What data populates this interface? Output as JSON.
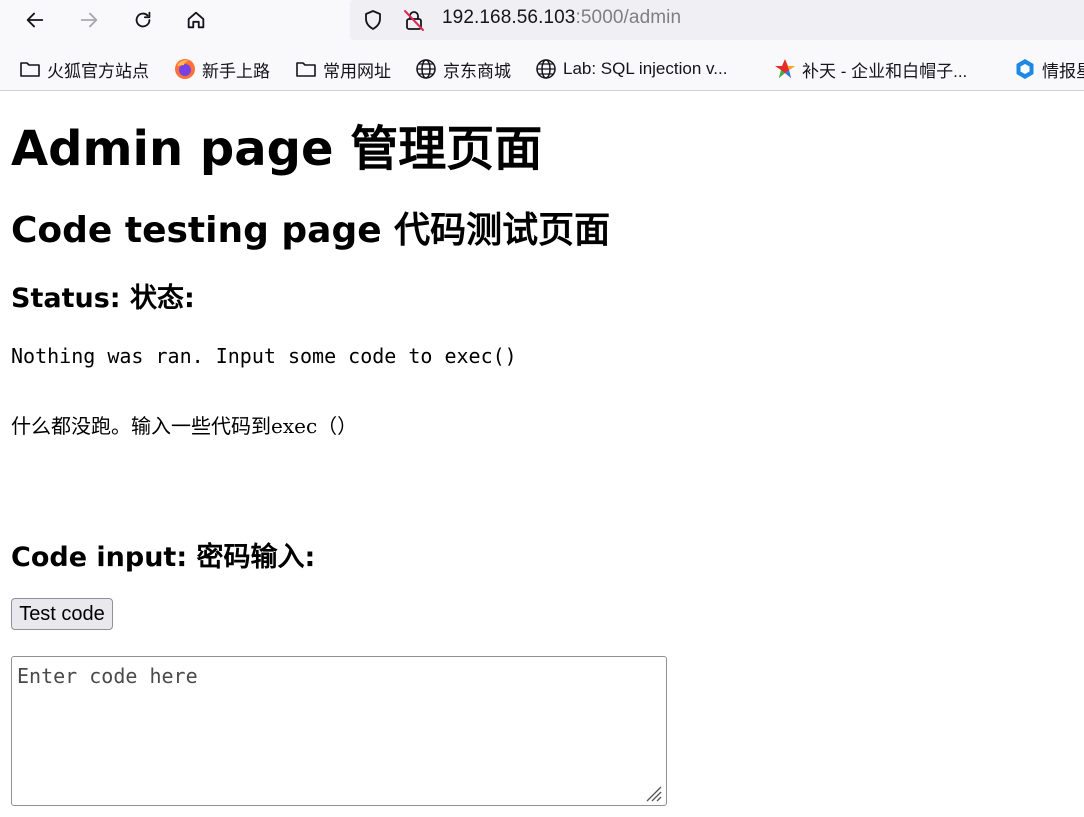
{
  "browser": {
    "url_host": "192.168.56.103",
    "url_path": ":5000/admin",
    "bookmarks": [
      {
        "label": "火狐官方站点",
        "icon": "folder-icon"
      },
      {
        "label": "新手上路",
        "icon": "firefox-icon"
      },
      {
        "label": "常用网址",
        "icon": "folder-icon"
      },
      {
        "label": "京东商城",
        "icon": "globe-icon"
      },
      {
        "label": "Lab: SQL injection v...",
        "icon": "globe-icon"
      },
      {
        "label": "补天 - 企业和白帽子...",
        "icon": "butian-star-icon"
      },
      {
        "label": "情报星",
        "icon": "hexagon-icon"
      }
    ]
  },
  "page": {
    "title": "Admin page 管理页面",
    "section_title": "Code testing page 代码测试页面",
    "status_heading": "Status: 状态:",
    "status_line_en": "Nothing was ran. Input some code to exec()",
    "status_line_zh": "什么都没跑。输入一些代码到exec（）",
    "code_heading": "Code input: 密码输入:",
    "test_button_label": "Test code",
    "code_placeholder": "Enter code here"
  },
  "colors": {
    "chrome_bg": "#f9f9fb",
    "urlbar_bg": "#f0f0f4",
    "url_path": "#7e7e86",
    "button_bg": "#e9e9ed"
  }
}
